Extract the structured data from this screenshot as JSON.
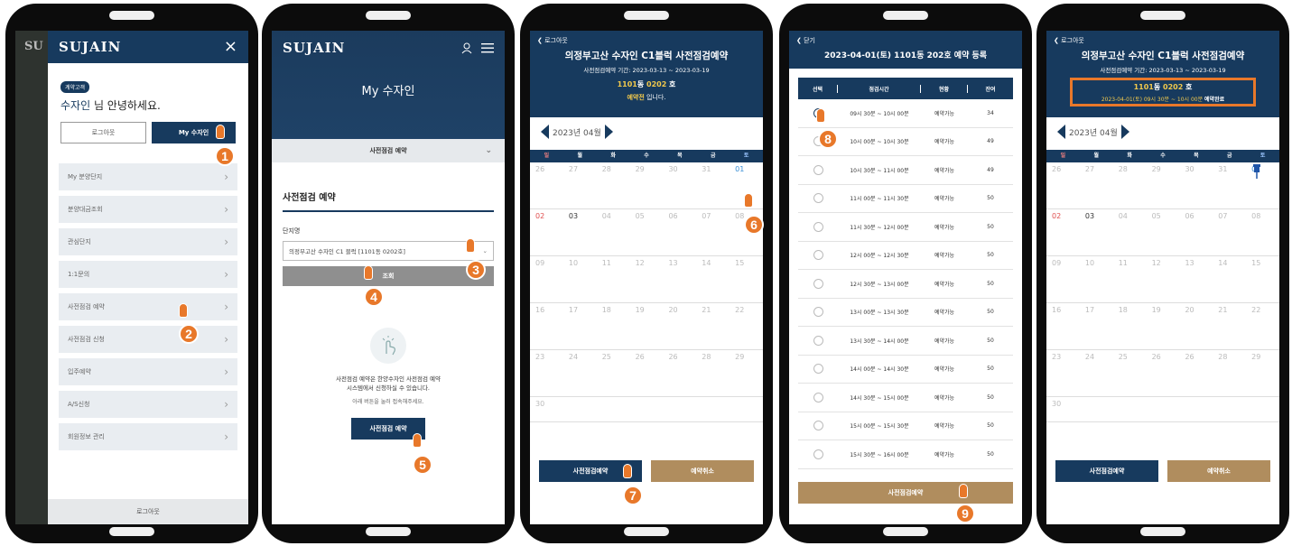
{
  "markers": [
    "1",
    "2",
    "3",
    "4",
    "5",
    "6",
    "7",
    "8",
    "9"
  ],
  "screen1": {
    "brand": "SUJAIN",
    "bg_text": "SU",
    "badge": "계약고객",
    "greeting_name": "수자인",
    "greeting_rest": " 님 안녕하세요.",
    "logout_button": "로그아웃",
    "my_button": "My 수자인",
    "menu": [
      "My 분양단지",
      "분양대금조회",
      "관심단지",
      "1:1문의",
      "사전점검 예약",
      "사전점검 신청",
      "입주예약",
      "A/S신청",
      "회원정보 관리"
    ],
    "footer_button": "로그아웃"
  },
  "screen2": {
    "brand": "SUJAIN",
    "banner_title": "My 수자인",
    "dropdown_label": "사전점검 예약",
    "section_title": "사전점검 예약",
    "field_label": "단지명",
    "select_value": "의정부고산 수자인 C1 블럭 [1101동 0202호]",
    "search_button": "조회",
    "info_line1": "사전점검 예약은 한양수자인 사전점검 예약",
    "info_line2": "시스템에서 신청하실 수 있습니다.",
    "info_line3": "아래 버튼을 눌러 접속해주세요.",
    "action_button": "사전점검 예약"
  },
  "screen3": {
    "back_label": "로그아웃",
    "title": "의정부고산 수자인 C1블럭 사전점검예약",
    "period": "사전점검예약 기간: 2023-03-13 ~ 2023-03-19",
    "unit_prefix": "1101",
    "unit_dong": "동 ",
    "unit_num": "0202",
    "unit_ho": " 호",
    "status_highlight": "예약전",
    "status_rest": " 입니다.",
    "month": "2023년 04월",
    "weekdays": [
      "일",
      "월",
      "화",
      "수",
      "목",
      "금",
      "토"
    ],
    "weeks": [
      [
        "26",
        "27",
        "28",
        "29",
        "30",
        "31",
        "01"
      ],
      [
        "02",
        "03",
        "04",
        "05",
        "06",
        "07",
        "08"
      ],
      [
        "09",
        "10",
        "11",
        "12",
        "13",
        "14",
        "15"
      ],
      [
        "16",
        "17",
        "18",
        "19",
        "20",
        "21",
        "22"
      ],
      [
        "23",
        "24",
        "25",
        "26",
        "26",
        "28",
        "29"
      ],
      [
        "30",
        "",
        "",
        "",
        "",
        "",
        ""
      ]
    ],
    "avail_1": "예약",
    "avail_2": "가능",
    "btn_reserve": "사전점검예약",
    "btn_cancel": "예약취소"
  },
  "screen4": {
    "back_label": "닫기",
    "title": "2023-04-01(토) 1101동 202호 예약 등록",
    "headers": [
      "선택",
      "점검시간",
      "현황",
      "잔여"
    ],
    "rows": [
      [
        "09시 30분 ~ 10시 00분",
        "예약가능",
        "34"
      ],
      [
        "10시 00분 ~ 10시 30분",
        "예약가능",
        "49"
      ],
      [
        "10시 30분 ~ 11시 00분",
        "예약가능",
        "49"
      ],
      [
        "11시 00분 ~ 11시 30분",
        "예약가능",
        "50"
      ],
      [
        "11시 30분 ~ 12시 00분",
        "예약가능",
        "50"
      ],
      [
        "12시 00분 ~ 12시 30분",
        "예약가능",
        "50"
      ],
      [
        "12시 30분 ~ 13시 00분",
        "예약가능",
        "50"
      ],
      [
        "13시 00분 ~ 13시 30분",
        "예약가능",
        "50"
      ],
      [
        "13시 30분 ~ 14시 00분",
        "예약가능",
        "50"
      ],
      [
        "14시 00분 ~ 14시 30분",
        "예약가능",
        "50"
      ],
      [
        "14시 30분 ~ 15시 00분",
        "예약가능",
        "50"
      ],
      [
        "15시 00분 ~ 15시 30분",
        "예약가능",
        "50"
      ],
      [
        "15시 30분 ~ 16시 00분",
        "예약가능",
        "50"
      ]
    ],
    "submit": "사전점검예약"
  },
  "screen5": {
    "back_label": "로그아웃",
    "title": "의정부고산 수자인 C1블럭 사전점검예약",
    "period": "사전점검예약 기간: 2023-03-13 ~ 2023-03-19",
    "unit_prefix": "1101",
    "unit_dong": "동 ",
    "unit_num": "0202",
    "unit_ho": " 호",
    "confirm_text": "2023-04-01(토) 09시 30분 ~ 10시 00분 ",
    "confirm_status": "예약완료",
    "month": "2023년 04월",
    "btn_reserve": "사전점검예약",
    "btn_cancel": "예약취소"
  },
  "colors": {
    "navy": "#173a5e",
    "orange": "#e8782a",
    "tan": "#b08d5e",
    "highlight": "#f2c94c"
  }
}
